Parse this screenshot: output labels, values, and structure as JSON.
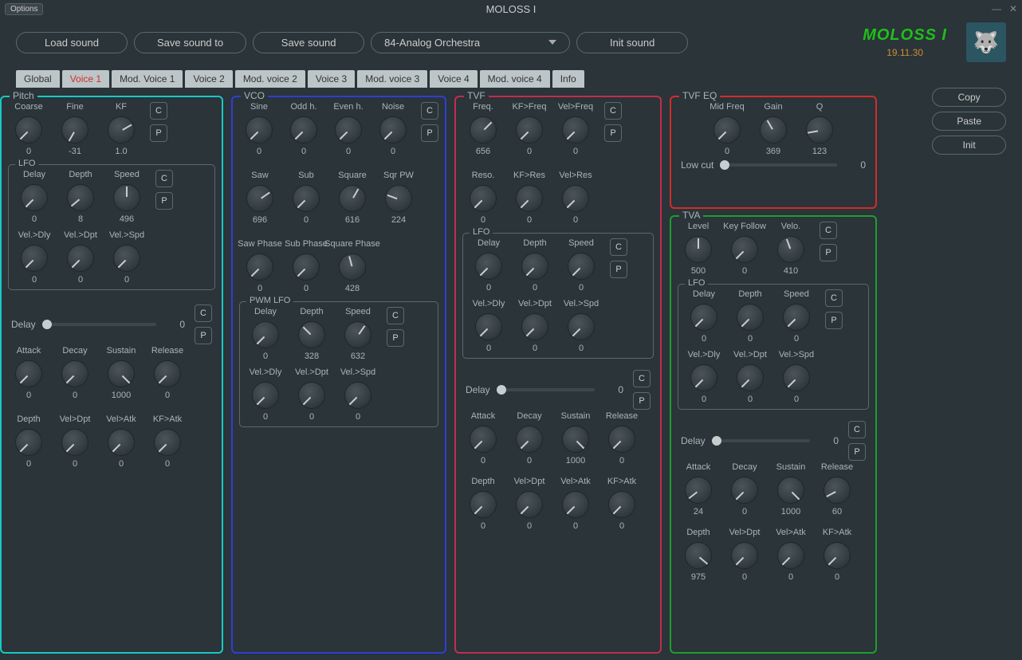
{
  "title": "MOLOSS I",
  "options_label": "Options",
  "toolbar": {
    "load": "Load sound",
    "save_to": "Save sound to",
    "save": "Save sound",
    "preset": "84-Analog Orchestra",
    "init": "Init sound"
  },
  "brand": {
    "name": "MOLOSS I",
    "date": "19.11.30"
  },
  "tabs": [
    "Global",
    "Voice 1",
    "Mod. Voice 1",
    "Voice 2",
    "Mod. voice 2",
    "Voice 3",
    "Mod. voice 3",
    "Voice 4",
    "Mod. voice 4",
    "Info"
  ],
  "active_tab": 1,
  "right": {
    "copy": "Copy",
    "paste": "Paste",
    "init": "Init"
  },
  "cp": {
    "c": "C",
    "p": "P"
  },
  "labels": {
    "lfo": "LFO",
    "pwm_lfo": "PWM LFO",
    "delay": "Delay",
    "low_cut": "Low cut"
  },
  "pitch": {
    "title": "Pitch",
    "row1": [
      {
        "l": "Coarse",
        "v": 0,
        "a": -135
      },
      {
        "l": "Fine",
        "v": -31,
        "a": -150
      },
      {
        "l": "KF",
        "v": "1.0",
        "a": 60
      }
    ],
    "lfo": [
      {
        "l": "Delay",
        "v": 0,
        "a": -135
      },
      {
        "l": "Depth",
        "v": 8,
        "a": -130
      },
      {
        "l": "Speed",
        "v": 496,
        "a": 0
      }
    ],
    "lfo2": [
      {
        "l": "Vel.>Dly",
        "v": 0,
        "a": -135
      },
      {
        "l": "Vel.>Dpt",
        "v": 0,
        "a": -135
      },
      {
        "l": "Vel.>Spd",
        "v": 0,
        "a": -135
      }
    ],
    "delay": 0,
    "adsr": [
      {
        "l": "Attack",
        "v": 0,
        "a": -135
      },
      {
        "l": "Decay",
        "v": 0,
        "a": -135
      },
      {
        "l": "Sustain",
        "v": 1000,
        "a": 135
      },
      {
        "l": "Release",
        "v": 0,
        "a": -135
      }
    ],
    "mods": [
      {
        "l": "Depth",
        "v": 0,
        "a": -135
      },
      {
        "l": "Vel>Dpt",
        "v": 0,
        "a": -135
      },
      {
        "l": "Vel>Atk",
        "v": 0,
        "a": -135
      },
      {
        "l": "KF>Atk",
        "v": 0,
        "a": -135
      }
    ]
  },
  "vco": {
    "title": "VCO",
    "row1": [
      {
        "l": "Sine",
        "v": 0,
        "a": -135
      },
      {
        "l": "Odd h.",
        "v": 0,
        "a": -135
      },
      {
        "l": "Even h.",
        "v": 0,
        "a": -135
      },
      {
        "l": "Noise",
        "v": 0,
        "a": -135
      }
    ],
    "row2": [
      {
        "l": "Saw",
        "v": 696,
        "a": 55
      },
      {
        "l": "Sub",
        "v": 0,
        "a": -135
      },
      {
        "l": "Square",
        "v": 616,
        "a": 30
      },
      {
        "l": "Sqr PW",
        "v": 224,
        "a": -70
      }
    ],
    "row3": [
      {
        "l": "Saw Phase",
        "v": 0,
        "a": -135
      },
      {
        "l": "Sub Phase",
        "v": 0,
        "a": -135
      },
      {
        "l": "Square Phase",
        "v": 428,
        "a": -15
      }
    ],
    "pwm": [
      {
        "l": "Delay",
        "v": 0,
        "a": -135
      },
      {
        "l": "Depth",
        "v": 328,
        "a": -45
      },
      {
        "l": "Speed",
        "v": 632,
        "a": 35
      }
    ],
    "pwm2": [
      {
        "l": "Vel.>Dly",
        "v": 0,
        "a": -135
      },
      {
        "l": "Vel.>Dpt",
        "v": 0,
        "a": -135
      },
      {
        "l": "Vel.>Spd",
        "v": 0,
        "a": -135
      }
    ]
  },
  "tvf": {
    "title": "TVF",
    "row1": [
      {
        "l": "Freq.",
        "v": 656,
        "a": 45
      },
      {
        "l": "KF>Freq",
        "v": 0,
        "a": -135
      },
      {
        "l": "Vel>Freq",
        "v": 0,
        "a": -135
      }
    ],
    "row2": [
      {
        "l": "Reso.",
        "v": 0,
        "a": -135
      },
      {
        "l": "KF>Res",
        "v": 0,
        "a": -135
      },
      {
        "l": "Vel>Res",
        "v": 0,
        "a": -135
      }
    ],
    "lfo": [
      {
        "l": "Delay",
        "v": 0,
        "a": -135
      },
      {
        "l": "Depth",
        "v": 0,
        "a": -135
      },
      {
        "l": "Speed",
        "v": 0,
        "a": -135
      }
    ],
    "lfo2": [
      {
        "l": "Vel.>Dly",
        "v": 0,
        "a": -135
      },
      {
        "l": "Vel.>Dpt",
        "v": 0,
        "a": -135
      },
      {
        "l": "Vel.>Spd",
        "v": 0,
        "a": -135
      }
    ],
    "delay": 0,
    "adsr": [
      {
        "l": "Attack",
        "v": 0,
        "a": -135
      },
      {
        "l": "Decay",
        "v": 0,
        "a": -135
      },
      {
        "l": "Sustain",
        "v": 1000,
        "a": 135
      },
      {
        "l": "Release",
        "v": 0,
        "a": -135
      }
    ],
    "mods": [
      {
        "l": "Depth",
        "v": 0,
        "a": -135
      },
      {
        "l": "Vel>Dpt",
        "v": 0,
        "a": -135
      },
      {
        "l": "Vel>Atk",
        "v": 0,
        "a": -135
      },
      {
        "l": "KF>Atk",
        "v": 0,
        "a": -135
      }
    ]
  },
  "tvfeq": {
    "title": "TVF EQ",
    "row": [
      {
        "l": "Mid Freq",
        "v": 0,
        "a": -135
      },
      {
        "l": "Gain",
        "v": 369,
        "a": -30
      },
      {
        "l": "Q",
        "v": 123,
        "a": -100
      }
    ],
    "low_cut": 0
  },
  "tva": {
    "title": "TVA",
    "row1": [
      {
        "l": "Level",
        "v": 500,
        "a": 0
      },
      {
        "l": "Key Follow",
        "v": 0,
        "a": -135
      },
      {
        "l": "Velo.",
        "v": 410,
        "a": -20
      }
    ],
    "lfo": [
      {
        "l": "Delay",
        "v": 0,
        "a": -135
      },
      {
        "l": "Depth",
        "v": 0,
        "a": -135
      },
      {
        "l": "Speed",
        "v": 0,
        "a": -135
      }
    ],
    "lfo2": [
      {
        "l": "Vel.>Dly",
        "v": 0,
        "a": -135
      },
      {
        "l": "Vel.>Dpt",
        "v": 0,
        "a": -135
      },
      {
        "l": "Vel.>Spd",
        "v": 0,
        "a": -135
      }
    ],
    "delay": 0,
    "adsr": [
      {
        "l": "Attack",
        "v": 24,
        "a": -128
      },
      {
        "l": "Decay",
        "v": 0,
        "a": -135
      },
      {
        "l": "Sustain",
        "v": 1000,
        "a": 135
      },
      {
        "l": "Release",
        "v": 60,
        "a": -118
      }
    ],
    "mods": [
      {
        "l": "Depth",
        "v": 975,
        "a": 130
      },
      {
        "l": "Vel>Dpt",
        "v": 0,
        "a": -135
      },
      {
        "l": "Vel>Atk",
        "v": 0,
        "a": -135
      },
      {
        "l": "KF>Atk",
        "v": 0,
        "a": -135
      }
    ]
  }
}
